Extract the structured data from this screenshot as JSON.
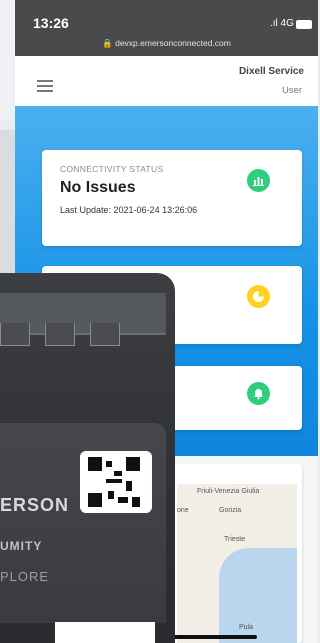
{
  "status_bar": {
    "time": "13:26",
    "network": ".ıl 4G",
    "url": "devxp.emersonconnected.com"
  },
  "header": {
    "user_name": "Dixell Service",
    "user_role": "User"
  },
  "connectivity_card": {
    "label": "CONNECTIVITY STATUS",
    "status": "No Issues",
    "last_update": "Last Update: 2021-06-24 13:26:06"
  },
  "map_labels": {
    "region": "Friuli-Venezia Giulia",
    "city1": "Gorizia",
    "city2": "Trieste",
    "city3": "Pula",
    "partial": "one"
  },
  "device_labels": {
    "brand": "ERSON",
    "line2": "UMITY",
    "line3": "PLORE"
  },
  "colors": {
    "accent_blue": "#1592e6",
    "green": "#2ecf7c",
    "yellow": "#ffd21f"
  }
}
